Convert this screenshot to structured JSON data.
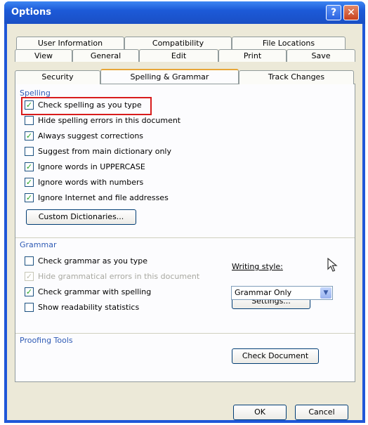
{
  "window": {
    "title": "Options",
    "help_glyph": "?",
    "close_glyph": "✕"
  },
  "tabs": {
    "row1": [
      "User Information",
      "Compatibility",
      "File Locations"
    ],
    "row2": [
      "View",
      "General",
      "Edit",
      "Print",
      "Save"
    ],
    "row3": [
      "Security",
      "Spelling & Grammar",
      "Track Changes"
    ],
    "active": "Spelling & Grammar"
  },
  "spelling": {
    "heading": "Spelling",
    "options": [
      {
        "label": "Check spelling as you type",
        "checked": true,
        "highlighted": true
      },
      {
        "label": "Hide spelling errors in this document",
        "checked": false
      },
      {
        "label": "Always suggest corrections",
        "checked": true
      },
      {
        "label": "Suggest from main dictionary only",
        "checked": false
      },
      {
        "label": "Ignore words in UPPERCASE",
        "checked": true
      },
      {
        "label": "Ignore words with numbers",
        "checked": true
      },
      {
        "label": "Ignore Internet and file addresses",
        "checked": true
      }
    ],
    "custom_dictionaries_label": "Custom Dictionaries..."
  },
  "grammar": {
    "heading": "Grammar",
    "options": [
      {
        "label": "Check grammar as you type",
        "checked": false
      },
      {
        "label": "Hide grammatical errors in this document",
        "checked": true,
        "disabled": true
      },
      {
        "label": "Check grammar with spelling",
        "checked": true
      },
      {
        "label": "Show readability statistics",
        "checked": false
      }
    ],
    "writing_style_label": "Writing style:",
    "writing_style_value": "Grammar Only",
    "settings_label": "Settings..."
  },
  "proofing": {
    "heading": "Proofing Tools",
    "check_document_label": "Check Document"
  },
  "footer": {
    "ok_label": "OK",
    "cancel_label": "Cancel"
  },
  "colors": {
    "titlebar": "#1f57d8",
    "section_heading": "#2f5bb5",
    "highlight": "#d81c1c",
    "checkmark": "#21a121"
  }
}
